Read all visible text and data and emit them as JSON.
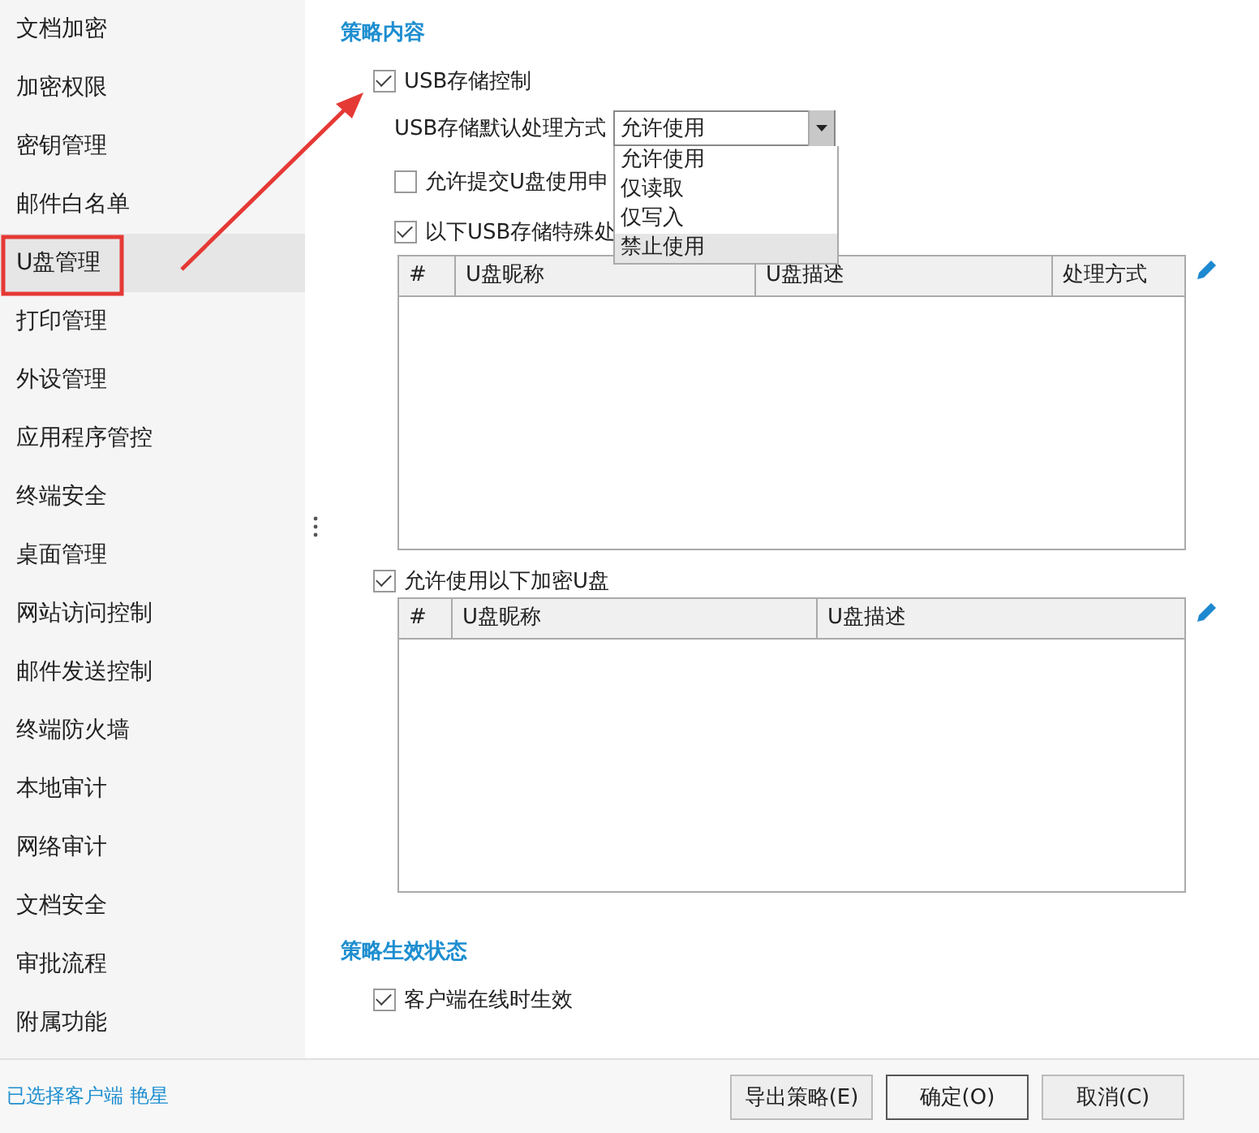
{
  "sidebar": {
    "items": [
      {
        "label": "文档加密",
        "selected": false
      },
      {
        "label": "加密权限",
        "selected": false
      },
      {
        "label": "密钥管理",
        "selected": false
      },
      {
        "label": "邮件白名单",
        "selected": false
      },
      {
        "label": "U盘管理",
        "selected": true
      },
      {
        "label": "打印管理",
        "selected": false
      },
      {
        "label": "外设管理",
        "selected": false
      },
      {
        "label": "应用程序管控",
        "selected": false
      },
      {
        "label": "终端安全",
        "selected": false
      },
      {
        "label": "桌面管理",
        "selected": false
      },
      {
        "label": "网站访问控制",
        "selected": false
      },
      {
        "label": "邮件发送控制",
        "selected": false
      },
      {
        "label": "终端防火墙",
        "selected": false
      },
      {
        "label": "本地审计",
        "selected": false
      },
      {
        "label": "网络审计",
        "selected": false
      },
      {
        "label": "文档安全",
        "selected": false
      },
      {
        "label": "审批流程",
        "selected": false
      },
      {
        "label": "附属功能",
        "selected": false
      }
    ]
  },
  "policy": {
    "heading": "策略内容",
    "usb_control": {
      "label": "USB存储控制",
      "checked": true
    },
    "default_action": {
      "label": "USB存储默认处理方式",
      "value": "允许使用",
      "expanded": true,
      "options": [
        {
          "label": "允许使用",
          "highlighted": false
        },
        {
          "label": "仅读取",
          "highlighted": false
        },
        {
          "label": "仅写入",
          "highlighted": false
        },
        {
          "label": "禁止使用",
          "highlighted": true
        }
      ]
    },
    "allow_request": {
      "label": "允许提交U盘使用申",
      "checked": false
    },
    "special_handling": {
      "label": "以下USB存储特殊处",
      "checked": true
    },
    "special_table": {
      "columns": [
        "#",
        "U盘昵称",
        "U盘描述",
        "处理方式"
      ]
    },
    "allow_encrypted": {
      "label": "允许使用以下加密U盘",
      "checked": true
    },
    "encrypted_table": {
      "columns": [
        "#",
        "U盘昵称",
        "U盘描述"
      ]
    }
  },
  "status": {
    "heading": "策略生效状态",
    "online": {
      "label": "客户端在线时生效",
      "checked": true
    }
  },
  "footer": {
    "selected_client": "已选择客户端 艳星",
    "buttons": [
      "导出策略(E)",
      "确定(O)",
      "取消(C)"
    ]
  }
}
